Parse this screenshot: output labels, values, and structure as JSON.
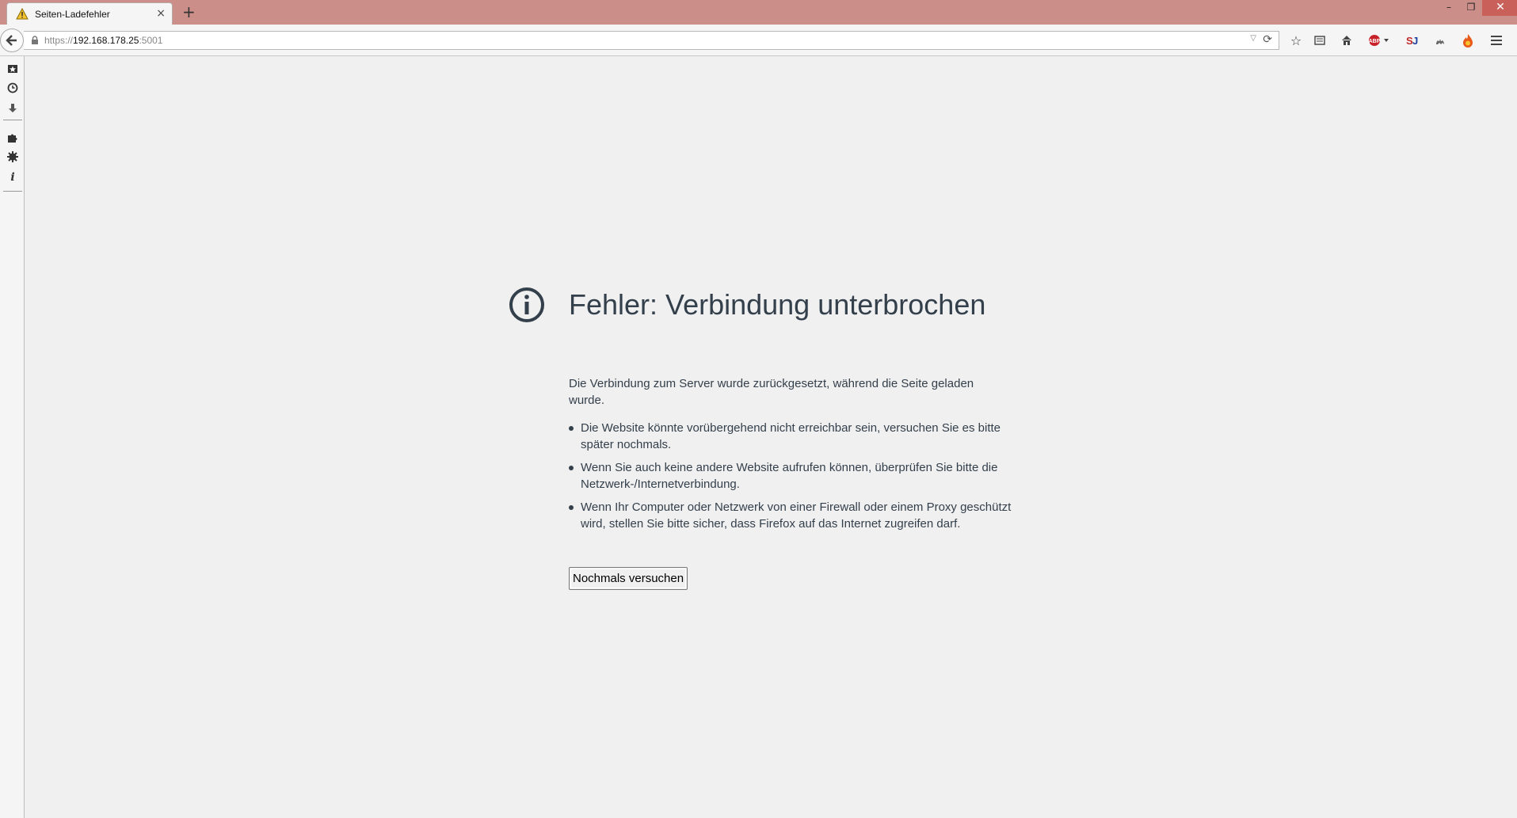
{
  "browser": {
    "tab_title": "Seiten-Ladefehler",
    "tab_close": "×",
    "new_tab": "+",
    "window_controls": {
      "minimize": "–",
      "restore": "❐",
      "close": "✕"
    },
    "url": {
      "scheme": "https://",
      "host": "192.168.178.25",
      "port": ":5001"
    },
    "toolbar_icons": [
      "bookmark-star-icon",
      "reading-list-icon",
      "home-icon",
      "adblock-plus-icon",
      "sj-extension-icon",
      "ghost-extension-icon",
      "fire-extension-icon",
      "menu-icon"
    ],
    "sidebar_icons": [
      "bookmarks-sidebar-icon",
      "history-icon",
      "downloads-icon",
      "addons-icon",
      "settings-gear-icon",
      "info-icon"
    ]
  },
  "error_page": {
    "title": "Fehler: Verbindung unterbrochen",
    "description": "Die Verbindung zum Server wurde zurückgesetzt, während die Seite geladen wurde.",
    "bullets": [
      "Die Website könnte vorübergehend nicht erreichbar sein, versuchen Sie es bitte später nochmals.",
      "Wenn Sie auch keine andere Website aufrufen können, überprüfen Sie bitte die Netzwerk-/Internetverbindung.",
      "Wenn Ihr Computer oder Netzwerk von einer Firewall oder einem Proxy geschützt wird, stellen Sie bitte sicher, dass Firefox auf das Internet zugreifen darf."
    ],
    "retry_label": "Nochmals versuchen"
  },
  "colors": {
    "titlebar": "#cc8e88",
    "text": "#333f4b",
    "page_bg": "#f0f0f0"
  }
}
